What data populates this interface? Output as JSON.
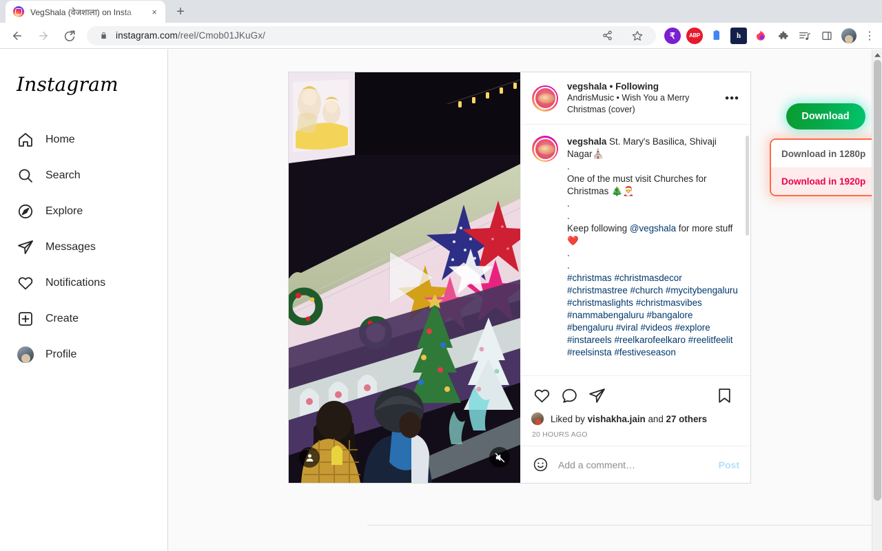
{
  "browser": {
    "tab": {
      "title": "VegShala (वेजशाला) on Insta",
      "favicon": "instagram-icon",
      "close": "×"
    },
    "new_tab_label": "+",
    "nav": {
      "back": "←",
      "forward": "→",
      "reload": "⟳"
    },
    "omnibox": {
      "lock": "lock-icon",
      "url_host": "instagram.com",
      "url_path": "/reel/Cmob01JKuGx/",
      "share": "share-icon",
      "bookmark": "star-icon"
    },
    "extensions": [
      {
        "name": "rupee-extension-icon",
        "glyph": "₹"
      },
      {
        "name": "abp-adblock-icon",
        "glyph": "ABP"
      },
      {
        "name": "clipboard-edit-icon",
        "glyph": "📋"
      },
      {
        "name": "hbox-extension-icon",
        "glyph": "h"
      },
      {
        "name": "flame-extension-icon",
        "glyph": "🔥"
      },
      {
        "name": "puzzle-extensions-icon",
        "glyph": "🧩"
      },
      {
        "name": "reading-list-icon",
        "glyph": "≡♪"
      },
      {
        "name": "side-panel-icon",
        "glyph": "▯"
      }
    ],
    "profile_avatar": "profile-avatar",
    "menu": "⋮"
  },
  "sidebar": {
    "logo": "Instagram",
    "items": [
      {
        "label": "Home",
        "icon": "home-icon"
      },
      {
        "label": "Search",
        "icon": "search-icon"
      },
      {
        "label": "Explore",
        "icon": "compass-icon"
      },
      {
        "label": "Messages",
        "icon": "paper-plane-icon"
      },
      {
        "label": "Notifications",
        "icon": "heart-icon"
      },
      {
        "label": "Create",
        "icon": "plus-square-icon"
      },
      {
        "label": "Profile",
        "icon": "profile-avatar-icon"
      }
    ]
  },
  "post": {
    "header": {
      "username": "vegshala",
      "separator": "•",
      "following": "Following",
      "audio": "AndrisMusic • Wish You a Merry Christmas (cover)",
      "more": "•••"
    },
    "caption": {
      "author": "vegshala",
      "location_line": " St. Mary's Basilica, Shivaji Nagar⛪",
      "body_lines": [
        ".",
        "One of the must visit Churches for Christmas 🎄🎅",
        ".",
        "."
      ],
      "follow_prefix": "Keep following ",
      "mention": "@vegshala",
      "follow_suffix": " for more stuff ❤️",
      "hashtags": "#christmas #christmasdecor #christmastree #church #mycitybengaluru #christmaslights #christmasvibes #nammabengaluru #bangalore #bengaluru #viral #videos #explore #instareels #reelkarofeelkaro #reelitfeelit #reelsinsta #festiveseason"
    },
    "actions": {
      "like": "heart-icon",
      "comment": "comment-bubble-icon",
      "share": "paper-plane-icon",
      "save": "bookmark-icon"
    },
    "likes": {
      "prefix": "Liked by ",
      "user": "vishakha.jain",
      "middle": " and ",
      "others": "27 others"
    },
    "timestamp": "20 HOURS AGO",
    "comment_box": {
      "emoji": "smiley-icon",
      "placeholder": "Add a comment…",
      "value": "",
      "post_label": "Post"
    },
    "video": {
      "play_icon": "play-triangle-icon",
      "person_badge": "person-tag-icon",
      "mute_badge": "muted-speaker-icon"
    }
  },
  "downloader": {
    "main_label": "Download",
    "options": [
      {
        "label": "Download in 1280p",
        "state": "normal"
      },
      {
        "label": "Download in 1920p",
        "state": "highlighted"
      }
    ],
    "colors": {
      "button_green_dark": "#0a9c2f",
      "button_green_light": "#02c56e",
      "menu_border": "#fc6b4a",
      "highlight_red": "#f0004b",
      "highlight_bg": "#fdeceb"
    }
  }
}
